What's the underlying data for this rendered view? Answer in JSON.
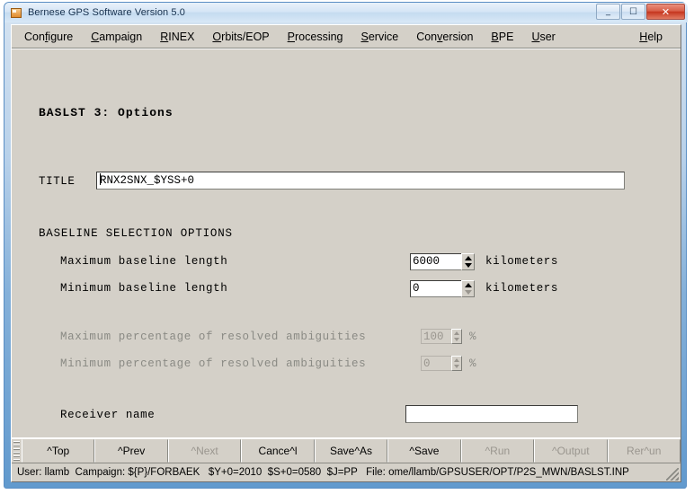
{
  "window": {
    "title": "Bernese GPS Software Version 5.0",
    "icon": "app-document-icon",
    "buttons": {
      "minimize": "—",
      "maximize": "❐",
      "close": "✕"
    }
  },
  "menu": {
    "items": [
      {
        "pre": "Con",
        "mnemonic": "f",
        "post": "igure"
      },
      {
        "pre": "",
        "mnemonic": "C",
        "post": "ampaign"
      },
      {
        "pre": "",
        "mnemonic": "R",
        "post": "INEX"
      },
      {
        "pre": "",
        "mnemonic": "O",
        "post": "rbits/EOP"
      },
      {
        "pre": "",
        "mnemonic": "P",
        "post": "rocessing"
      },
      {
        "pre": "",
        "mnemonic": "S",
        "post": "ervice"
      },
      {
        "pre": "Con",
        "mnemonic": "v",
        "post": "ersion"
      },
      {
        "pre": "",
        "mnemonic": "B",
        "post": "PE"
      },
      {
        "pre": "",
        "mnemonic": "U",
        "post": "ser"
      }
    ],
    "help": {
      "pre": "",
      "mnemonic": "H",
      "post": "elp"
    }
  },
  "form": {
    "page_title": "BASLST 3: Options",
    "title_label": "TITLE",
    "title_value": "RNX2SNX_$YSS+0",
    "section_heading": "BASELINE SELECTION OPTIONS",
    "max_baseline_label": "Maximum baseline length",
    "max_baseline_value": "6000",
    "max_baseline_units": "kilometers",
    "min_baseline_label": "Minimum baseline length",
    "min_baseline_value": "0",
    "min_baseline_units": "kilometers",
    "max_ambig_label": "Maximum percentage of resolved ambiguities",
    "max_ambig_value": "100",
    "max_ambig_units": "%",
    "min_ambig_label": "Minimum percentage of resolved ambiguities",
    "min_ambig_value": "0",
    "min_ambig_units": "%",
    "receiver_label": "Receiver name",
    "receiver_value": ""
  },
  "buttons": [
    {
      "label": "^Top",
      "disabled": false
    },
    {
      "label": "^Prev",
      "disabled": false
    },
    {
      "label": "^Next",
      "disabled": true
    },
    {
      "label": "Cance^l",
      "disabled": false
    },
    {
      "label": "Save^As",
      "disabled": false
    },
    {
      "label": "^Save",
      "disabled": false
    },
    {
      "label": "^Run",
      "disabled": true
    },
    {
      "label": "^Output",
      "disabled": true
    },
    {
      "label": "Rer^un",
      "disabled": true
    }
  ],
  "status": {
    "text": "User: llamb  Campaign: ${P}/FORBAEK   $Y+0=2010  $S+0=0580  $J=PP   File: ome/llamb/GPSUSER/OPT/P2S_MWN/BASLST.INP"
  },
  "colors": {
    "face": "#d4d0c8",
    "frame": "#5c96cc",
    "close": "#c5361f",
    "disabled_text": "#9a968f"
  }
}
